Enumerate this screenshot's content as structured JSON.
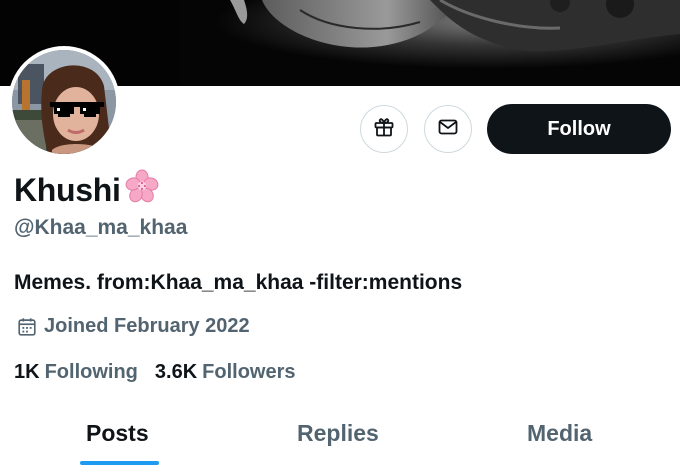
{
  "profile": {
    "display_name": "Khushi",
    "name_emoji": "cherry-blossom-emoji",
    "handle": "@Khaa_ma_khaa",
    "bio": "Memes. from:Khaa_ma_khaa -filter:mentions",
    "joined": "Joined February 2022"
  },
  "actions": {
    "gift_icon": "gift-icon",
    "message_icon": "envelope-icon",
    "follow_label": "Follow"
  },
  "stats": {
    "following_count": "1K",
    "following_label": "Following",
    "followers_count": "3.6K",
    "followers_label": "Followers"
  },
  "tabs": [
    {
      "label": "Posts",
      "active": true
    },
    {
      "label": "Replies",
      "active": false
    },
    {
      "label": "Media",
      "active": false
    }
  ],
  "colors": {
    "primary_text": "#0f1419",
    "secondary_text": "#536471",
    "accent": "#1d9bf0",
    "button_border": "#cfd9de",
    "follow_button_bg": "#0f1419"
  }
}
